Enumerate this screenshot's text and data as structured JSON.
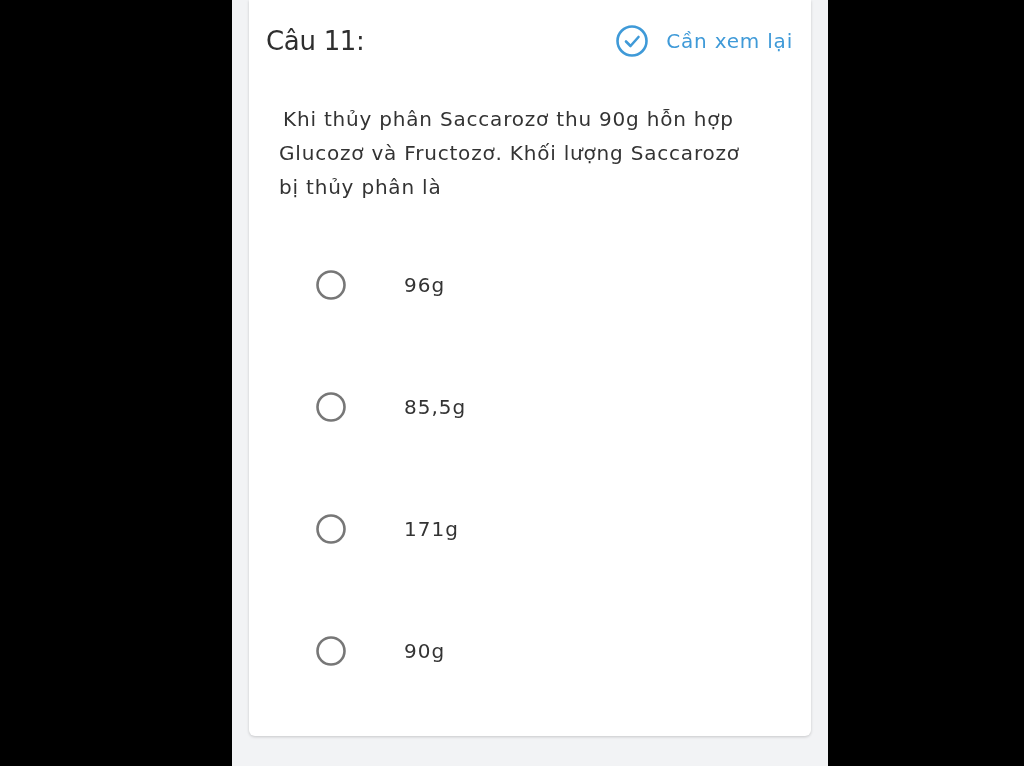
{
  "question": {
    "title": "Câu 11:",
    "review_button": {
      "label": "Cần xem lại"
    },
    "text": "Khi thủy phân Saccarozơ thu 90g hỗn hợp Glucozơ và Fructozơ. Khối lượng Saccarozơ bị thủy phân là",
    "options": [
      {
        "label": "96g",
        "selected": false
      },
      {
        "label": "85,5g",
        "selected": false
      },
      {
        "label": "171g",
        "selected": false
      },
      {
        "label": "90g",
        "selected": false
      }
    ]
  }
}
